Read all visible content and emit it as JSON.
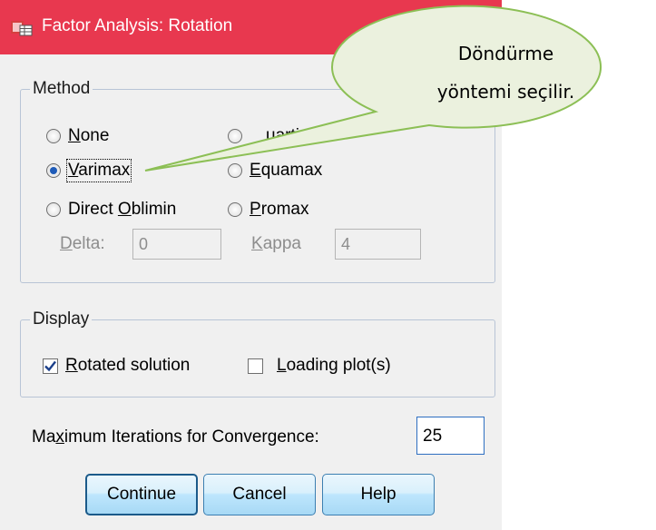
{
  "titlebar": {
    "title": "Factor Analysis: Rotation",
    "icon": "spss-app-icon",
    "color": "#e8384f"
  },
  "method": {
    "legend": "Method",
    "options": [
      {
        "label": "None",
        "hotkey": "N",
        "rest": "one",
        "selected": false
      },
      {
        "label": "Quartimax",
        "visible_text": "uartimax",
        "selected": false
      },
      {
        "label": "Varimax",
        "hotkey": "V",
        "rest": "arimax",
        "selected": true
      },
      {
        "label": "Equamax",
        "hotkey": "E",
        "rest": "quamax",
        "selected": false
      },
      {
        "label": "Direct Oblimin",
        "prefix": "Direct ",
        "hotkey": "O",
        "rest": "blimin",
        "selected": false
      },
      {
        "label": "Promax",
        "hotkey": "P",
        "rest": "romax",
        "selected": false
      }
    ],
    "delta": {
      "hotkey": "D",
      "rest": "elta:",
      "value": "0"
    },
    "kappa": {
      "hotkey": "K",
      "rest": "appa",
      "value": "4"
    }
  },
  "display": {
    "legend": "Display",
    "rotated": {
      "hotkey": "R",
      "rest": "otated solution",
      "checked": true
    },
    "loading": {
      "hotkey": "L",
      "rest": "oading plot(s)",
      "checked": false
    }
  },
  "iterations": {
    "pre": "Ma",
    "hotkey": "x",
    "post": "imum Iterations for Convergence:",
    "value": "25"
  },
  "buttons": {
    "continue": "Continue",
    "cancel": "Cancel",
    "help": "Help"
  },
  "callout": {
    "line1": "Döndürme",
    "line2": "yöntemi seçilir.",
    "fill": "#ebf1de",
    "stroke": "#8cbf55"
  }
}
